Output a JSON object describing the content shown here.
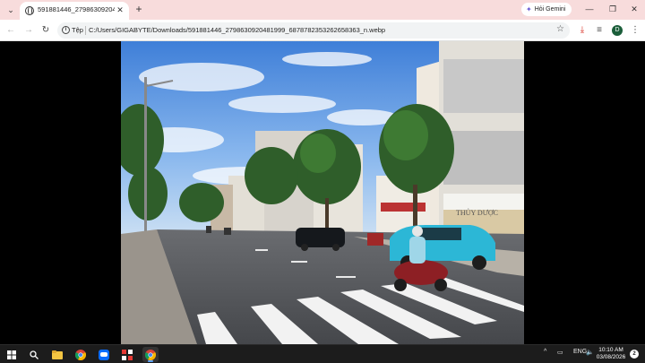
{
  "tab": {
    "title": "591881446_2798630920481999_6878782353262658363_n.webp",
    "close_glyph": "✕"
  },
  "tabstrip": {
    "menu_glyph": "⌄",
    "new_tab_glyph": "+",
    "gemini_label": "Hỏi Gemini",
    "gemini_icon": "✦"
  },
  "window_controls": {
    "minimize": "—",
    "maximize": "❐",
    "close": "✕"
  },
  "toolbar": {
    "back_glyph": "←",
    "forward_glyph": "→",
    "reload_glyph": "↻",
    "chip_label": "Tệp",
    "url": "C:/Users/GIGABYTE/Downloads/591881446_2798630920481999_6878782353262658363_n.webp",
    "star_glyph": "☆",
    "download_glyph": "⤓",
    "media_glyph": "≡",
    "avatar_letter": "D",
    "menu_glyph": "⋮"
  },
  "taskbar": {
    "tray_chevron": "^",
    "tray_network": "▭",
    "tray_volume": "🔈",
    "language": "ENG",
    "time": "10:10 AM",
    "date": "03/08/2026",
    "notification_count": "2"
  },
  "colors": {
    "tabstrip": "#f8dcdc",
    "accent": "#1a73e8",
    "avatar": "#1b5e3a",
    "taskbar": "#1c1c1c"
  },
  "photo": {
    "shop_sign": "THỦY DƯỢC"
  }
}
